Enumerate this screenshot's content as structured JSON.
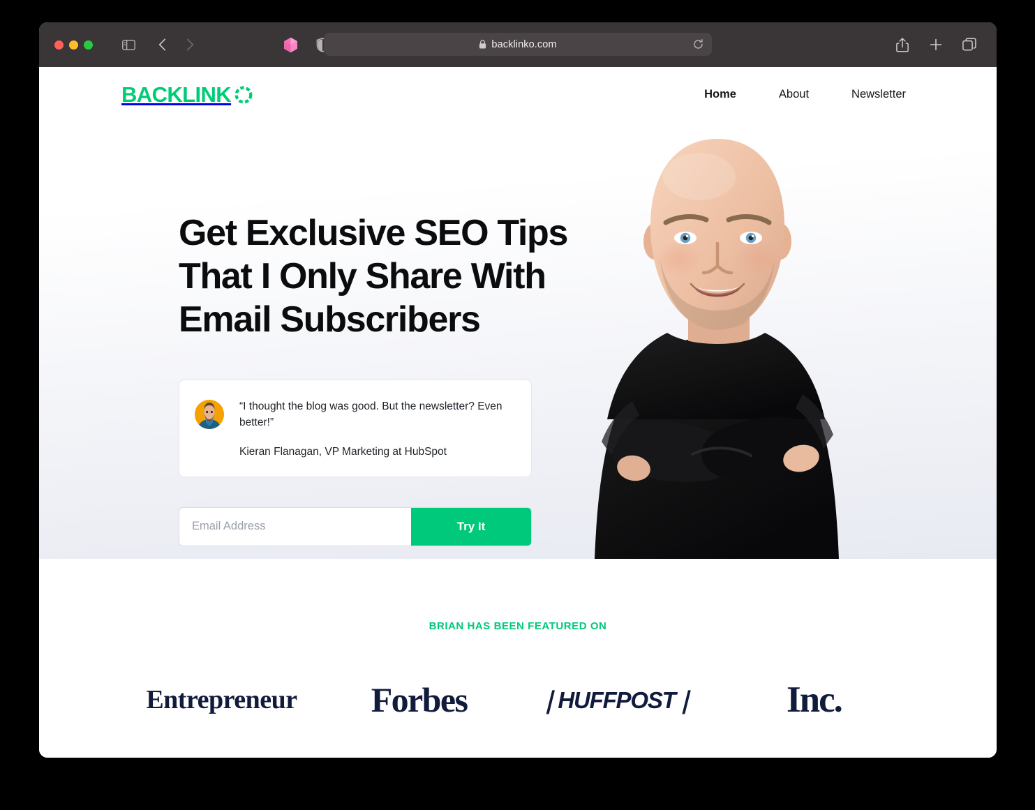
{
  "browser": {
    "traffic_lights": [
      "close",
      "minimize",
      "maximize"
    ],
    "sidebar_toggle_icon": "sidebar-icon",
    "back_icon": "chevron-left-icon",
    "forward_icon": "chevron-right-icon",
    "extension_icon": "cube-extension-icon",
    "privacy_icon": "shield-icon",
    "url": "backlinko.com",
    "lock_icon": "lock-icon",
    "reload_icon": "reload-icon",
    "share_icon": "share-icon",
    "new_tab_icon": "plus-icon",
    "tabs_icon": "tab-overview-icon"
  },
  "site": {
    "logo_text": "BACKLINK",
    "logo_mark": "dotted-circle-o-icon",
    "brand_green": "#00c97c",
    "nav": [
      {
        "label": "Home",
        "active": true
      },
      {
        "label": "About",
        "active": false
      },
      {
        "label": "Newsletter",
        "active": false
      }
    ]
  },
  "hero": {
    "headline": "Get Exclusive SEO Tips That I Only Share With Email Subscribers",
    "portrait_alt": "brian-dean-portrait",
    "testimonial": {
      "avatar_alt": "kieran-flanagan-avatar",
      "quote": "“I thought the blog was good. But the newsletter? Even better!”",
      "attribution": "Kieran Flanagan, VP Marketing at HubSpot"
    },
    "form": {
      "email_placeholder": "Email Address",
      "email_value": "",
      "submit_label": "Try It"
    }
  },
  "featured": {
    "eyebrow": "BRIAN HAS BEEN FEATURED ON",
    "logos": [
      {
        "name": "entrepreneur",
        "label": "Entrepreneur"
      },
      {
        "name": "forbes",
        "label": "Forbes"
      },
      {
        "name": "huffpost",
        "label": "❘HUFFPOST❘"
      },
      {
        "name": "inc",
        "label": "Inc."
      }
    ],
    "logo_color": "#111b3c"
  }
}
